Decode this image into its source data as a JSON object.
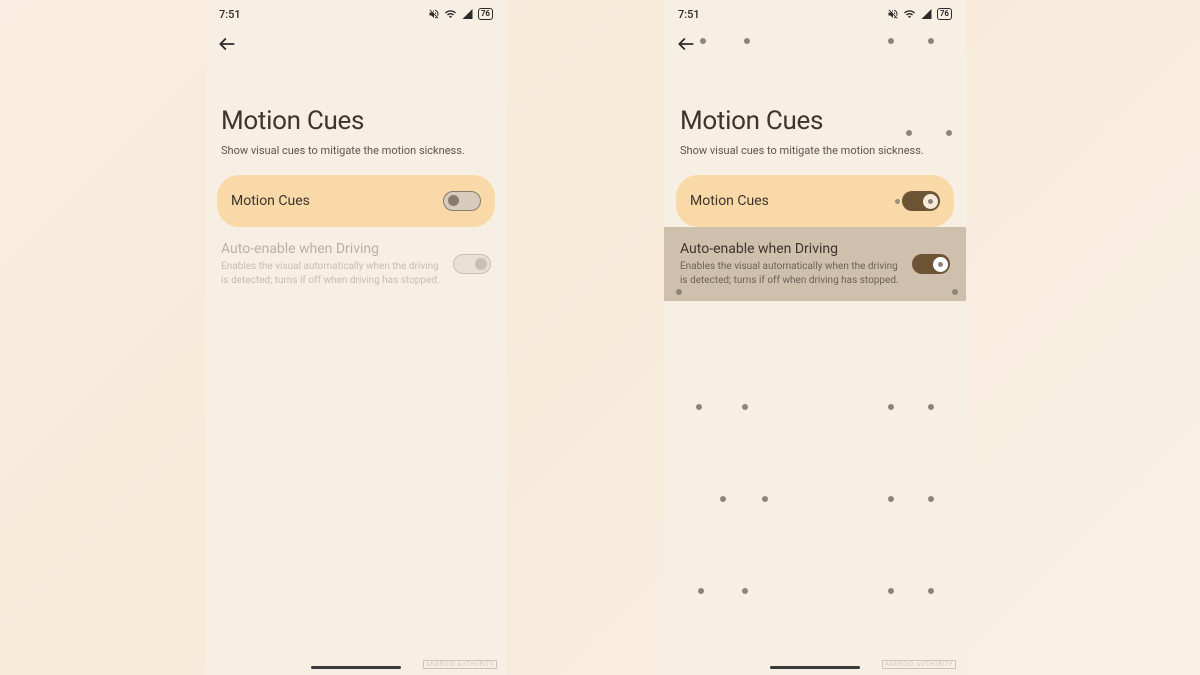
{
  "status": {
    "time": "7:51",
    "battery": "76"
  },
  "page": {
    "title": "Motion Cues",
    "subtitle": "Show visual cues to mitigate the motion sickness."
  },
  "toggle": {
    "label": "Motion Cues"
  },
  "auto": {
    "title": "Auto-enable when Driving",
    "desc": "Enables the visual automatically when the driving is detected; turns if off when driving has stopped."
  },
  "watermark": "ANDROID AUTHORITY",
  "screens": {
    "left": {
      "motion_on": false,
      "auto_enabled": false,
      "auto_on": false
    },
    "right": {
      "motion_on": true,
      "auto_enabled": true,
      "auto_on": true
    }
  },
  "colors": {
    "card_bg": "#fad9a8",
    "switch_on": "#6b5334",
    "bg": "#f8efe4"
  }
}
